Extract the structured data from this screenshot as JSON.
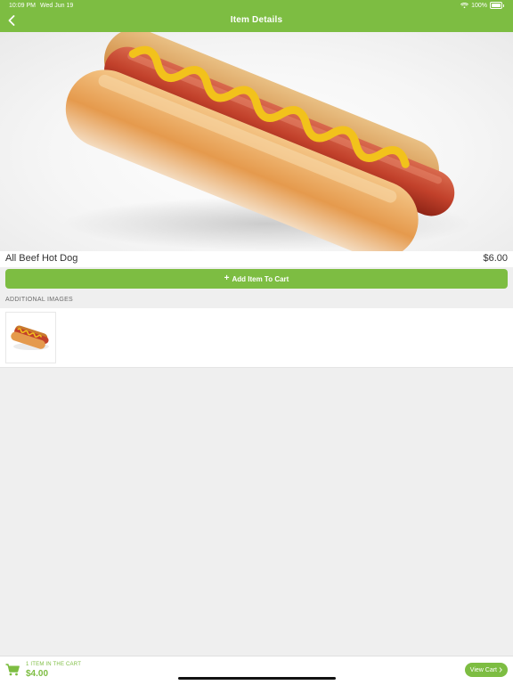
{
  "status_bar": {
    "time": "10:09 PM",
    "date": "Wed Jun 19",
    "battery": "100%"
  },
  "header": {
    "title": "Item Details",
    "back_icon": "chevron-left-icon"
  },
  "item": {
    "name": "All Beef Hot Dog",
    "price": "$6.00"
  },
  "add_button": {
    "label": "Add Item To Cart",
    "icon": "plus-icon"
  },
  "additional_images": {
    "label": "ADDITIONAL IMAGES"
  },
  "cart": {
    "count_text": "1 ITEM IN THE CART",
    "total": "$4.00",
    "view_label": "View Cart",
    "icon": "cart-icon"
  },
  "colors": {
    "accent": "#7dbd42",
    "background": "#efefef"
  }
}
